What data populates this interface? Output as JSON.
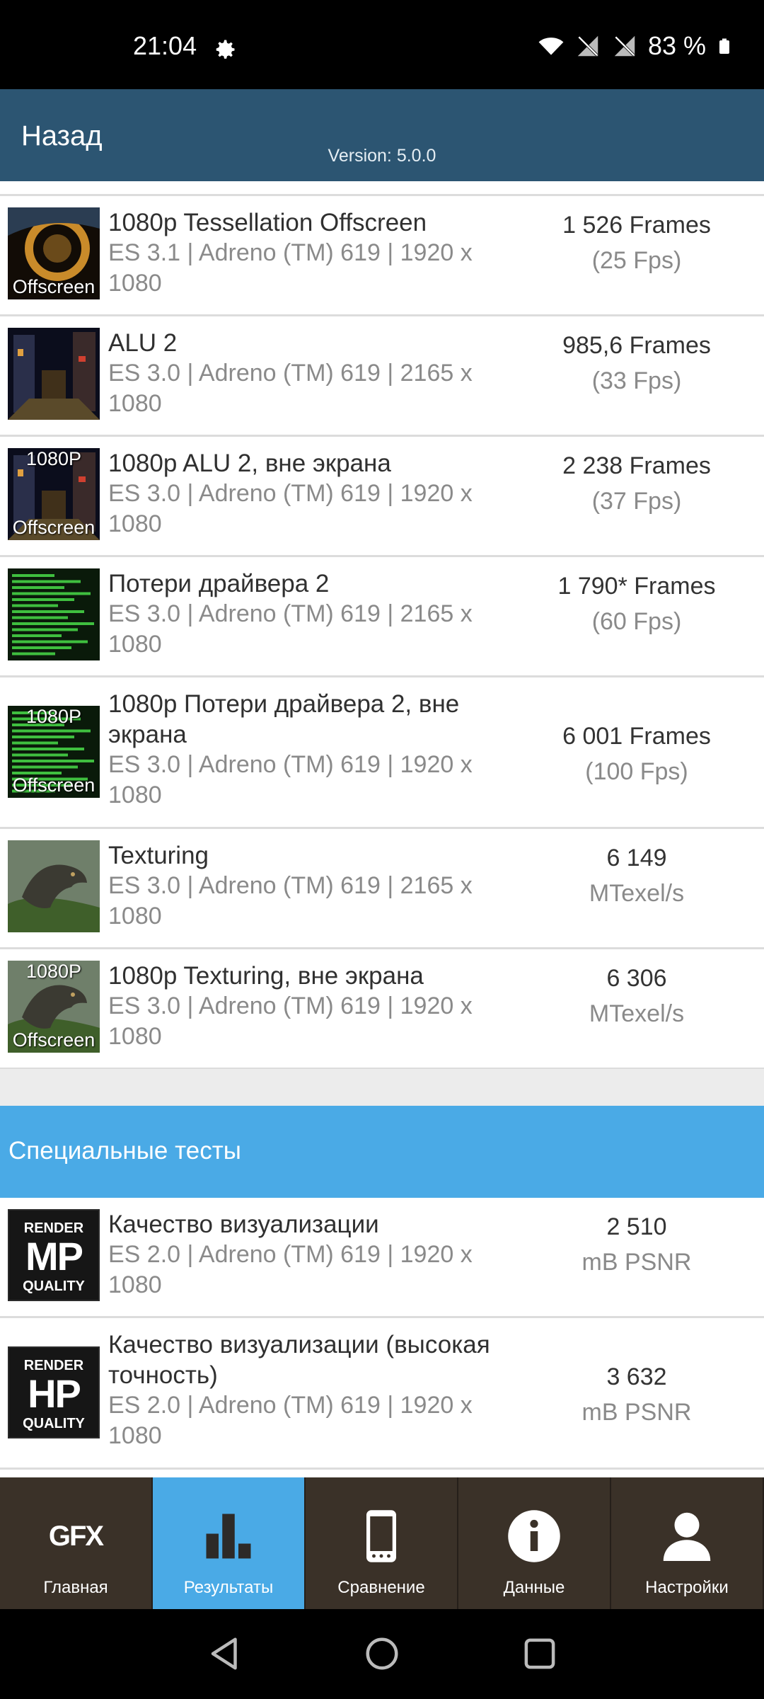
{
  "status": {
    "time": "21:04",
    "battery": "83 %"
  },
  "header": {
    "back_label": "Назад",
    "version": "Version: 5.0.0"
  },
  "results": [
    {
      "title": "1080p Tessellation Offscreen",
      "sub": "ES 3.1 | Adreno (TM) 619 | 1920 x 1080",
      "score": "1 526 Frames",
      "unit": "(25 Fps)",
      "thumb_top": "",
      "thumb_bottom": "Offscreen",
      "thumb_kind": "tess"
    },
    {
      "title": "ALU 2",
      "sub": "ES 3.0 | Adreno (TM) 619 | 2165 x 1080",
      "score": "985,6 Frames",
      "unit": "(33 Fps)",
      "thumb_top": "",
      "thumb_bottom": "",
      "thumb_kind": "alu"
    },
    {
      "title": "1080p ALU 2, вне экрана",
      "sub": "ES 3.0 | Adreno (TM) 619 | 1920 x 1080",
      "score": "2 238 Frames",
      "unit": "(37 Fps)",
      "thumb_top": "1080P",
      "thumb_bottom": "Offscreen",
      "thumb_kind": "alu"
    },
    {
      "title": "Потери драйвера 2",
      "sub": "ES 3.0 | Adreno (TM) 619 | 2165 x 1080",
      "score": "1 790* Frames",
      "unit": "(60 Fps)",
      "thumb_top": "",
      "thumb_bottom": "",
      "thumb_kind": "driver"
    },
    {
      "title": "1080p Потери драйвера 2, вне экрана",
      "sub": "ES 3.0 | Adreno (TM) 619 | 1920 x 1080",
      "score": "6 001 Frames",
      "unit": "(100 Fps)",
      "thumb_top": "1080P",
      "thumb_bottom": "Offscreen",
      "thumb_kind": "driver"
    },
    {
      "title": "Texturing",
      "sub": "ES 3.0 | Adreno (TM) 619 | 2165 x 1080",
      "score": "6 149",
      "unit": "MTexel/s",
      "thumb_top": "",
      "thumb_bottom": "",
      "thumb_kind": "dino"
    },
    {
      "title": "1080p Texturing, вне экрана",
      "sub": "ES 3.0 | Adreno (TM) 619 | 1920 x 1080",
      "score": "6 306",
      "unit": "MTexel/s",
      "thumb_top": "1080P",
      "thumb_bottom": "Offscreen",
      "thumb_kind": "dino"
    }
  ],
  "special_section": {
    "title": "Специальные тесты"
  },
  "special": [
    {
      "title": "Качество визуализации",
      "sub": "ES 2.0 | Adreno (TM) 619 | 1920 x 1080",
      "score": "2 510",
      "unit": "mB PSNR",
      "badge_top": "RENDER",
      "badge_mid": "MP",
      "badge_bot": "QUALITY"
    },
    {
      "title": "Качество визуализации (высокая точность)",
      "sub": "ES 2.0 | Adreno (TM) 619 | 1920 x 1080",
      "score": "3 632",
      "unit": "mB PSNR",
      "badge_top": "RENDER",
      "badge_mid": "HP",
      "badge_bot": "QUALITY"
    }
  ],
  "tabs": [
    {
      "label": "Главная",
      "icon": "gfx-logo-icon",
      "logo_text": "GFX"
    },
    {
      "label": "Результаты",
      "icon": "bar-chart-icon"
    },
    {
      "label": "Сравнение",
      "icon": "phone-icon"
    },
    {
      "label": "Данные",
      "icon": "info-icon"
    },
    {
      "label": "Настройки",
      "icon": "user-icon"
    }
  ],
  "active_tab": "Результаты",
  "colors": {
    "appbar": "#2c5572",
    "accent": "#4aaae6",
    "tabbar": "#3a3128"
  }
}
